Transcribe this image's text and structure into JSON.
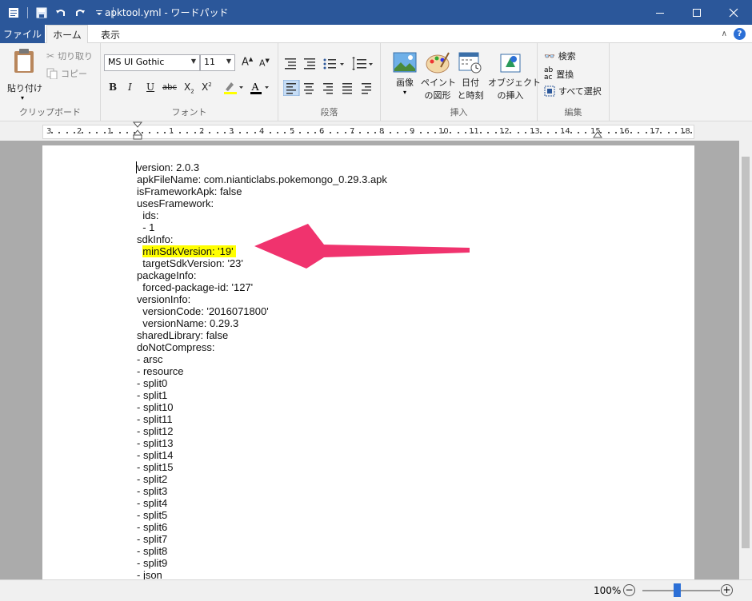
{
  "window": {
    "title": "apktool.yml - ワードパッド",
    "controls": [
      "minimize",
      "maximize",
      "close"
    ]
  },
  "ribbon": {
    "tabs": [
      {
        "label": "ファイル",
        "active": false
      },
      {
        "label": "ホーム",
        "active": true
      },
      {
        "label": "表示",
        "active": false
      }
    ],
    "clipboard": {
      "paste": "貼り付け",
      "cut": "切り取り",
      "copy": "コピー",
      "group": "クリップボード"
    },
    "font": {
      "family": "MS UI Gothic",
      "size": "11",
      "group": "フォント"
    },
    "paragraph": {
      "group": "段落"
    },
    "insert": {
      "picture": "画像",
      "paint1": "ペイント",
      "paint2": "の図形",
      "date1": "日付",
      "date2": "と時刻",
      "obj1": "オブジェクト",
      "obj2": "の挿入",
      "group": "挿入"
    },
    "edit": {
      "find": "検索",
      "replace": "置換",
      "selectall": "すべて選択",
      "group": "編集"
    }
  },
  "ruler": {
    "labels": [
      "3",
      "2",
      "1",
      "1",
      "2",
      "3",
      "4",
      "5",
      "6",
      "7",
      "8",
      "9",
      "10",
      "11",
      "12",
      "13",
      "14",
      "15",
      "16",
      "17",
      "18"
    ]
  },
  "document": {
    "lines": [
      "version: 2.0.3",
      "apkFileName: com.nianticlabs.pokemongo_0.29.3.apk",
      "isFrameworkApk: false",
      "usesFramework:",
      "  ids:",
      "  - 1",
      "sdkInfo:",
      "  minSdkVersion: '19'",
      "  targetSdkVersion: '23'",
      "packageInfo:",
      "  forced-package-id: '127'",
      "versionInfo:",
      "  versionCode: '2016071800'",
      "  versionName: 0.29.3",
      "sharedLibrary: false",
      "doNotCompress:",
      "- arsc",
      "- resource",
      "- split0",
      "- split1",
      "- split10",
      "- split11",
      "- split12",
      "- split13",
      "- split14",
      "- split15",
      "- split2",
      "- split3",
      "- split4",
      "- split5",
      "- split6",
      "- split7",
      "- split8",
      "- split9",
      "- json"
    ],
    "highlighted_line": "  minSdkVersion: '19'",
    "highlight_color": "#ffff00",
    "arrow_color": "#f0336e"
  },
  "status": {
    "zoom": "100%",
    "zoom_out": "−",
    "zoom_in": "+"
  }
}
